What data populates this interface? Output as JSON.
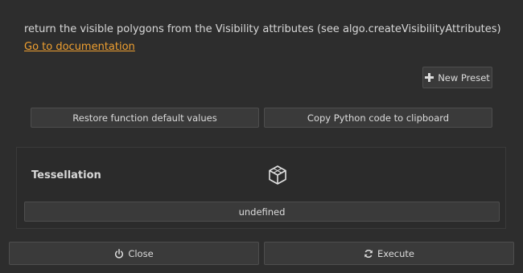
{
  "description": "return the visible polygons from the Visibility attributes (see algo.createVisibilityAttributes)",
  "doc_link": "Go to documentation",
  "toolbar": {
    "new_preset_label": "New Preset",
    "new_preset_icon": "plus-icon"
  },
  "actions": {
    "restore_label": "Restore function default values",
    "copy_label": "Copy Python code to clipboard"
  },
  "param": {
    "title": "Tessellation",
    "icon": "cube-icon",
    "value": "undefined"
  },
  "footer": {
    "close_label": "Close",
    "close_icon": "power-icon",
    "execute_label": "Execute",
    "execute_icon": "refresh-icon"
  },
  "colors": {
    "background": "#2d2d2d",
    "link": "#f0a030",
    "button": "#3a3a3a"
  }
}
